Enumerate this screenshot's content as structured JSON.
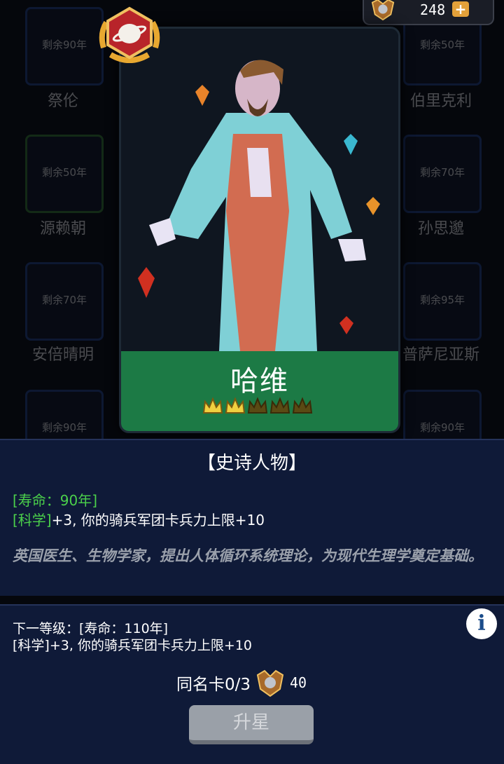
{
  "currency": {
    "amount": "248",
    "plus_label": "+"
  },
  "background_cards": [
    {
      "name": "祭伦",
      "remain": "剩余90年"
    },
    {
      "name": "伯里克利",
      "remain": "剩余50年"
    },
    {
      "name": "源赖朝",
      "remain": "剩余50年"
    },
    {
      "name": "孙思邈",
      "remain": "剩余70年"
    },
    {
      "name": "安倍晴明",
      "remain": "剩余70年"
    },
    {
      "name": "普萨尼亚斯",
      "remain": "剩余95年"
    },
    {
      "name": "",
      "remain": "剩余90年"
    },
    {
      "name": "",
      "remain": "剩余90年"
    }
  ],
  "card": {
    "name": "哈维",
    "stars_filled": 2,
    "stars_total": 5
  },
  "info": {
    "rarity": "【史诗人物】",
    "lifespan": "[寿命：90年]",
    "skill_tag": "[科学]",
    "skill_text": "+3, 你的骑兵军团卡兵力上限+10",
    "description": "英国医生、生物学家，提出人体循环系统理论，为现代生理学奠定基础。"
  },
  "next_level": {
    "line1": "下一等级：[寿命：110年]",
    "line2": "[科学]+3, 你的骑兵军团卡兵力上限+10"
  },
  "duplicate": {
    "label": "同名卡0/3",
    "cost": "40"
  },
  "upgrade_button": "升星",
  "info_icon": "i"
}
